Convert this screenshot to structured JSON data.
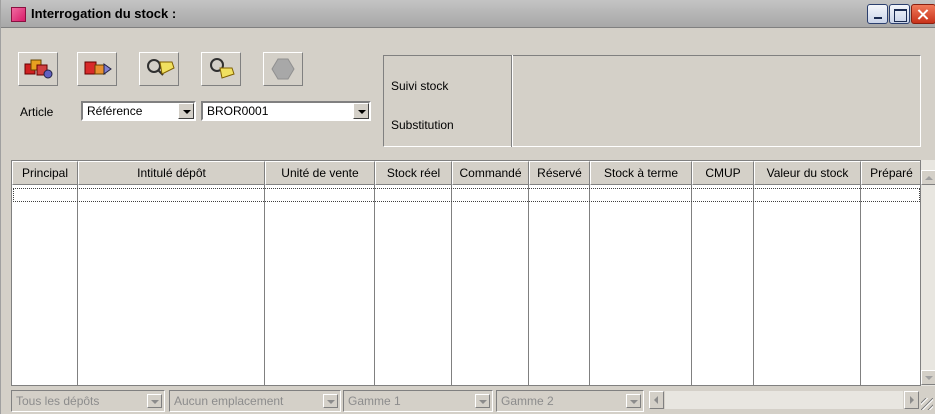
{
  "window": {
    "title": "Interrogation du stock :"
  },
  "toolbar": {
    "buttons": [
      {
        "icon": "stock-boxes-icon"
      },
      {
        "icon": "stock-move-icon"
      },
      {
        "icon": "tag-search-icon"
      },
      {
        "icon": "tag-search-alt-icon"
      },
      {
        "icon": "hexagon-icon"
      }
    ]
  },
  "article": {
    "label": "Article",
    "reference_select": "Référence",
    "code_value": "BROR0001"
  },
  "info": {
    "suivi_label": "Suivi stock",
    "substitution_label": "Substitution"
  },
  "grid": {
    "columns": [
      "Principal",
      "Intitulé dépôt",
      "Unité de vente",
      "Stock réel",
      "Commandé",
      "Réservé",
      "Stock à terme",
      "CMUP",
      "Valeur du stock",
      "Préparé"
    ],
    "rows": []
  },
  "filters": {
    "depots": "Tous les dépôts",
    "emplacement": "Aucun emplacement",
    "gamme1": "Gamme 1",
    "gamme2": "Gamme 2"
  },
  "colors": {
    "chrome": "#d4d0c8",
    "title_icon": "#e0307a"
  }
}
